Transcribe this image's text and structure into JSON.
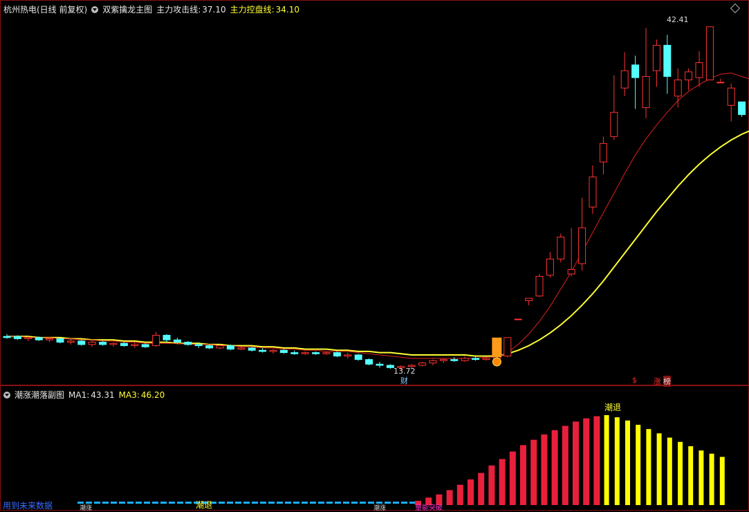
{
  "header": {
    "stock": "杭州热电(日线 前复权)",
    "indicator": "双紫擒龙主图",
    "attack_label": "主力攻击线:",
    "attack_value": "37.10",
    "control_label": "主力控盘线:",
    "control_value": "34.10"
  },
  "sub_header": {
    "title": "潮涨潮落副图",
    "ma1_label": "MA1:",
    "ma1_value": "43.31",
    "ma3_label": "MA3:",
    "ma3_value": "46.20"
  },
  "markers": {
    "high_label": "42.41",
    "low_label": "13.72",
    "cai": "财",
    "dollar": "$",
    "zhang": "涨",
    "bang": "榜",
    "chaotui_main": "潮退",
    "chaotui_low": "潮退",
    "future_link": "用到未来数据",
    "left_tag": "潮涨",
    "mid_tag": "潮涨",
    "red_tag": "量能突破"
  },
  "colors": {
    "up": "#ff3333",
    "down": "#55ffff",
    "attack_line": "#ffff33",
    "control_line": "#e02020",
    "hist_rise": "#e8203c",
    "hist_fall": "#ffff00",
    "hist_low": "#1ab0ff"
  },
  "chart_data": [
    {
      "type": "candlestick",
      "title": "双紫擒龙主图",
      "ylim": [
        12.5,
        44
      ],
      "candles": [
        {
          "o": 15.6,
          "h": 15.8,
          "l": 15.4,
          "c": 15.5
        },
        {
          "o": 15.6,
          "h": 15.7,
          "l": 15.3,
          "c": 15.4
        },
        {
          "o": 15.4,
          "h": 15.6,
          "l": 15.2,
          "c": 15.5
        },
        {
          "o": 15.5,
          "h": 15.6,
          "l": 15.2,
          "c": 15.3
        },
        {
          "o": 15.3,
          "h": 15.5,
          "l": 15.1,
          "c": 15.4
        },
        {
          "o": 15.4,
          "h": 15.5,
          "l": 15.0,
          "c": 15.1
        },
        {
          "o": 15.1,
          "h": 15.3,
          "l": 14.9,
          "c": 15.2
        },
        {
          "o": 15.2,
          "h": 15.3,
          "l": 14.8,
          "c": 14.9
        },
        {
          "o": 14.9,
          "h": 15.2,
          "l": 14.7,
          "c": 15.1
        },
        {
          "o": 15.1,
          "h": 15.2,
          "l": 14.8,
          "c": 14.9
        },
        {
          "o": 14.9,
          "h": 15.1,
          "l": 14.7,
          "c": 15.0
        },
        {
          "o": 15.0,
          "h": 15.1,
          "l": 14.7,
          "c": 14.8
        },
        {
          "o": 14.8,
          "h": 15.1,
          "l": 14.6,
          "c": 14.9
        },
        {
          "o": 14.9,
          "h": 15.0,
          "l": 14.6,
          "c": 14.7
        },
        {
          "o": 14.8,
          "h": 16.0,
          "l": 14.7,
          "c": 15.7
        },
        {
          "o": 15.7,
          "h": 15.8,
          "l": 15.1,
          "c": 15.3
        },
        {
          "o": 15.3,
          "h": 15.5,
          "l": 15.0,
          "c": 15.1
        },
        {
          "o": 15.1,
          "h": 15.2,
          "l": 14.8,
          "c": 14.9
        },
        {
          "o": 14.9,
          "h": 15.1,
          "l": 14.6,
          "c": 14.8
        },
        {
          "o": 14.8,
          "h": 14.9,
          "l": 14.5,
          "c": 14.6
        },
        {
          "o": 14.6,
          "h": 14.9,
          "l": 14.5,
          "c": 14.8
        },
        {
          "o": 14.8,
          "h": 14.9,
          "l": 14.4,
          "c": 14.5
        },
        {
          "o": 14.5,
          "h": 14.7,
          "l": 14.4,
          "c": 14.6
        },
        {
          "o": 14.6,
          "h": 14.7,
          "l": 14.3,
          "c": 14.4
        },
        {
          "o": 14.4,
          "h": 14.6,
          "l": 14.2,
          "c": 14.3
        },
        {
          "o": 14.3,
          "h": 14.5,
          "l": 14.1,
          "c": 14.4
        },
        {
          "o": 14.4,
          "h": 14.5,
          "l": 14.1,
          "c": 14.2
        },
        {
          "o": 14.2,
          "h": 14.4,
          "l": 14.0,
          "c": 14.1
        },
        {
          "o": 14.1,
          "h": 14.3,
          "l": 14.0,
          "c": 14.2
        },
        {
          "o": 14.2,
          "h": 14.3,
          "l": 14.0,
          "c": 14.1
        },
        {
          "o": 14.1,
          "h": 14.3,
          "l": 14.0,
          "c": 14.2
        },
        {
          "o": 14.2,
          "h": 14.3,
          "l": 13.8,
          "c": 13.9
        },
        {
          "o": 13.9,
          "h": 14.2,
          "l": 13.7,
          "c": 14.0
        },
        {
          "o": 14.0,
          "h": 14.1,
          "l": 13.5,
          "c": 13.6
        },
        {
          "o": 13.6,
          "h": 13.7,
          "l": 13.1,
          "c": 13.2
        },
        {
          "o": 13.2,
          "h": 13.4,
          "l": 12.9,
          "c": 13.1
        },
        {
          "o": 13.1,
          "h": 13.2,
          "l": 12.8,
          "c": 12.9
        },
        {
          "o": 12.9,
          "h": 13.1,
          "l": 12.7,
          "c": 13.0
        },
        {
          "o": 13.0,
          "h": 13.2,
          "l": 12.8,
          "c": 13.1
        },
        {
          "o": 13.1,
          "h": 13.4,
          "l": 13.0,
          "c": 13.3
        },
        {
          "o": 13.3,
          "h": 13.6,
          "l": 13.1,
          "c": 13.5
        },
        {
          "o": 13.5,
          "h": 13.7,
          "l": 13.3,
          "c": 13.6
        },
        {
          "o": 13.6,
          "h": 13.8,
          "l": 13.4,
          "c": 13.5
        },
        {
          "o": 13.5,
          "h": 13.9,
          "l": 13.4,
          "c": 13.7
        },
        {
          "o": 13.7,
          "h": 13.9,
          "l": 13.5,
          "c": 13.6
        },
        {
          "o": 13.6,
          "h": 13.8,
          "l": 13.5,
          "c": 13.7
        },
        {
          "o": 13.7,
          "h": 14.0,
          "l": 13.6,
          "c": 13.9
        },
        {
          "o": 13.9,
          "h": 15.5,
          "l": 13.8,
          "c": 15.5
        },
        {
          "o": 17.1,
          "h": 17.1,
          "l": 17.1,
          "c": 17.1
        },
        {
          "o": 18.7,
          "h": 18.9,
          "l": 18.3,
          "c": 18.9
        },
        {
          "o": 19.1,
          "h": 21.0,
          "l": 19.0,
          "c": 20.8
        },
        {
          "o": 20.9,
          "h": 22.9,
          "l": 20.7,
          "c": 22.3
        },
        {
          "o": 22.3,
          "h": 24.5,
          "l": 22.0,
          "c": 24.2
        },
        {
          "o": 21.0,
          "h": 25.0,
          "l": 20.8,
          "c": 21.4
        },
        {
          "o": 21.9,
          "h": 27.6,
          "l": 21.3,
          "c": 25.0
        },
        {
          "o": 26.8,
          "h": 30.4,
          "l": 26.2,
          "c": 29.4
        },
        {
          "o": 30.7,
          "h": 32.9,
          "l": 29.6,
          "c": 32.3
        },
        {
          "o": 32.9,
          "h": 38.2,
          "l": 32.6,
          "c": 35.0
        },
        {
          "o": 37.1,
          "h": 40.2,
          "l": 36.4,
          "c": 38.6
        },
        {
          "o": 39.1,
          "h": 39.9,
          "l": 35.3,
          "c": 38.0
        },
        {
          "o": 35.4,
          "h": 42.3,
          "l": 34.5,
          "c": 38.1
        },
        {
          "o": 38.6,
          "h": 41.3,
          "l": 37.2,
          "c": 40.8
        },
        {
          "o": 40.8,
          "h": 41.7,
          "l": 36.6,
          "c": 38.1
        },
        {
          "o": 36.4,
          "h": 38.8,
          "l": 35.4,
          "c": 37.8
        },
        {
          "o": 37.8,
          "h": 38.8,
          "l": 36.9,
          "c": 38.5
        },
        {
          "o": 38.0,
          "h": 40.3,
          "l": 37.2,
          "c": 39.3
        },
        {
          "o": 37.8,
          "h": 42.4,
          "l": 37.8,
          "c": 42.4
        },
        {
          "o": 37.6,
          "h": 37.9,
          "l": 37.6,
          "c": 37.6
        },
        {
          "o": 35.6,
          "h": 37.5,
          "l": 34.2,
          "c": 37.1
        },
        {
          "o": 35.9,
          "h": 35.9,
          "l": 34.6,
          "c": 34.8
        },
        {
          "o": 35.3,
          "h": 36.2,
          "l": 34.9,
          "c": 36.0
        },
        {
          "o": 35.6,
          "h": 37.8,
          "l": 34.8,
          "c": 36.8
        }
      ],
      "attack_line": [
        15.6,
        15.6,
        15.5,
        15.5,
        15.5,
        15.4,
        15.4,
        15.3,
        15.3,
        15.2,
        15.2,
        15.1,
        15.1,
        15.0,
        15.0,
        15.0,
        15.0,
        14.9,
        14.9,
        14.9,
        14.8,
        14.8,
        14.7,
        14.7,
        14.6,
        14.6,
        14.5,
        14.5,
        14.4,
        14.4,
        14.3,
        14.3,
        14.3,
        14.2,
        14.1,
        14.0,
        13.9,
        13.8,
        13.7,
        13.7,
        13.7,
        13.7,
        13.7,
        13.7,
        13.7,
        13.8,
        13.8,
        14.2,
        14.9,
        15.8,
        16.9,
        18.2,
        19.7,
        21.2,
        22.9,
        24.6,
        26.3,
        28.0,
        29.7,
        31.3,
        32.7,
        33.9,
        35.0,
        36.0,
        36.8,
        37.4,
        37.9,
        38.3,
        38.4,
        38.1,
        37.8,
        37.5,
        37.1
      ],
      "control_line": [
        15.6,
        15.6,
        15.6,
        15.5,
        15.5,
        15.5,
        15.4,
        15.4,
        15.3,
        15.3,
        15.3,
        15.2,
        15.2,
        15.1,
        15.1,
        15.1,
        15.0,
        15.0,
        15.0,
        14.9,
        14.9,
        14.8,
        14.8,
        14.8,
        14.7,
        14.7,
        14.6,
        14.6,
        14.5,
        14.5,
        14.5,
        14.4,
        14.4,
        14.3,
        14.3,
        14.2,
        14.2,
        14.1,
        14.0,
        14.0,
        14.0,
        14.0,
        14.0,
        14.0,
        13.9,
        13.9,
        13.9,
        14.1,
        14.4,
        14.8,
        15.3,
        15.9,
        16.6,
        17.4,
        18.3,
        19.3,
        20.4,
        21.6,
        22.8,
        24.0,
        25.2,
        26.4,
        27.5,
        28.6,
        29.6,
        30.5,
        31.3,
        32.0,
        32.6,
        33.1,
        33.5,
        33.8,
        34.1
      ]
    },
    {
      "type": "bar",
      "title": "潮涨潮落副图",
      "series": [
        {
          "name": "MA1",
          "values": [
            43.31
          ]
        },
        {
          "name": "MA3",
          "values": [
            46.2
          ]
        }
      ],
      "low_bars": [
        2,
        2,
        2,
        2,
        2,
        2,
        2,
        2,
        2,
        2,
        2,
        2,
        2,
        2,
        2,
        2,
        2,
        2,
        2,
        2,
        2,
        2,
        2,
        2,
        2,
        2,
        2,
        2,
        2,
        2,
        2,
        2,
        2,
        2,
        2,
        2,
        2,
        2,
        2,
        2,
        2
      ],
      "rise_bars": [
        4,
        7,
        10,
        14,
        19,
        24,
        30,
        37,
        43,
        50,
        56,
        61,
        66,
        70,
        74,
        78,
        81,
        83
      ],
      "fall_bars": [
        84,
        82,
        79,
        75,
        71,
        67,
        63,
        59,
        55,
        51,
        48,
        45
      ]
    }
  ]
}
